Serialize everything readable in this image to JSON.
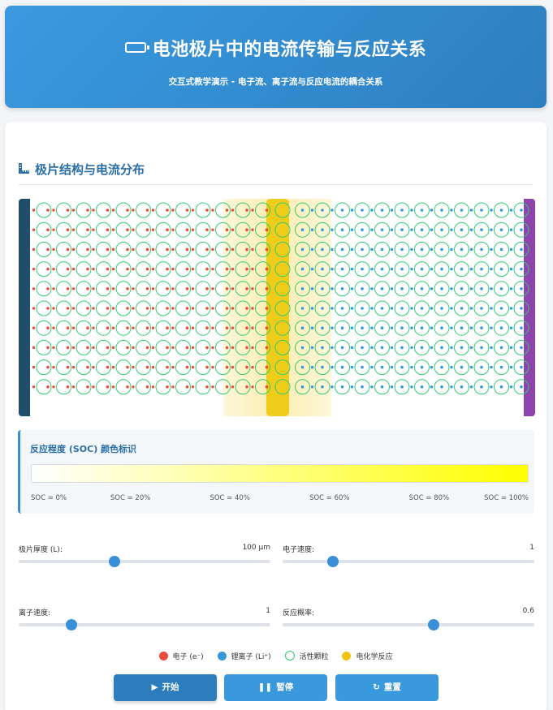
{
  "header": {
    "title": "电池极片中的电流传输与反应关系",
    "subtitle": "交互式教学演示 - 电子流、离子流与反应电流的耦合关系"
  },
  "section": {
    "title": "极片结构与电流分布"
  },
  "electrode": {
    "rows": 10,
    "cols": 25,
    "reaction_col": 12
  },
  "soc": {
    "title": "反应程度 (SOC) 颜色标识",
    "labels": [
      "SOC = 0%",
      "SOC = 20%",
      "SOC = 40%",
      "SOC = 60%",
      "SOC = 80%",
      "SOC = 100%"
    ]
  },
  "controls": {
    "thickness": {
      "label": "极片厚度 (L):",
      "value": "100 μm",
      "level": 0.38
    },
    "electron_speed": {
      "label": "电子速度:",
      "value": "1",
      "level": 0.2
    },
    "ion_speed": {
      "label": "离子速度:",
      "value": "1",
      "level": 0.21
    },
    "reaction_prob": {
      "label": "反应概率:",
      "value": "0.6",
      "level": 0.6
    }
  },
  "legend": {
    "electron": "电子 (e⁻)",
    "li_ion": "锂离子 (Li⁺)",
    "particle": "活性颗粒",
    "reaction": "电化学反应"
  },
  "buttons": {
    "start": "开始",
    "pause": "暂停",
    "reset": "重置"
  },
  "colors": {
    "electron": "#e74c3c",
    "ion": "#3498db",
    "particle_border": "#2ecc71",
    "reaction": "#f1c40f",
    "left_collector": "#1f4e6b",
    "right_collector": "#8e44ad"
  }
}
